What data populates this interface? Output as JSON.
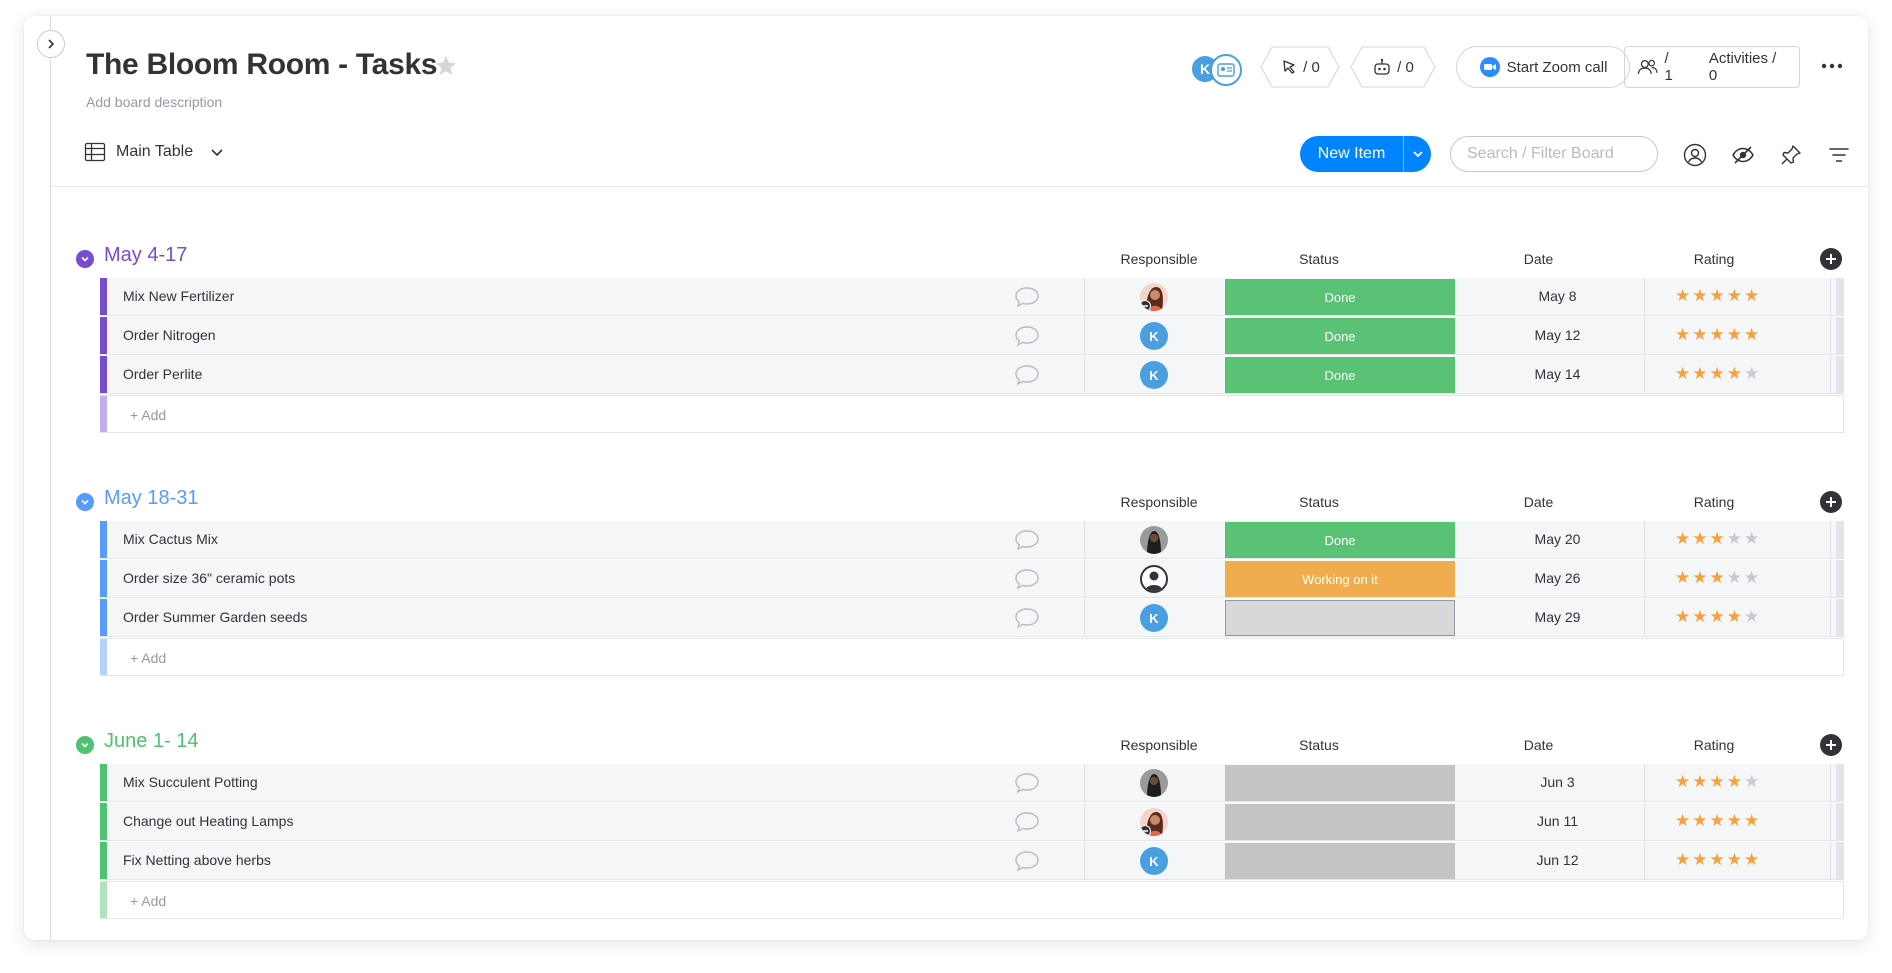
{
  "board": {
    "title": "The Bloom Room - Tasks",
    "description": "Add board description"
  },
  "header": {
    "avatar_initial": "K",
    "updates_count": "/ 0",
    "automations_count": "/ 0",
    "zoom_label": "Start Zoom call",
    "members_count": "/ 1",
    "activities_label": "Activities / 0"
  },
  "toolbar": {
    "view_label": "Main Table",
    "new_item_label": "New Item",
    "search_placeholder": "Search / Filter Board"
  },
  "columns": {
    "responsible": "Responsible",
    "status": "Status",
    "date": "Date",
    "rating": "Rating"
  },
  "colors": {
    "done": "#5ac274",
    "working": "#f0ad4e",
    "empty_status_1": "#d8d8d8",
    "empty_status_2": "#c4c4c4",
    "star_on": "#f5a23d",
    "star_off": "#c8c9cf"
  },
  "groups": [
    {
      "title": "May 4-17",
      "color": "#784bd1",
      "add_label": "+ Add",
      "items": [
        {
          "name": "Mix New Fertilizer",
          "responsible": "photo-woman",
          "status": "Done",
          "status_color": "#5ac274",
          "date": "May 8",
          "rating": 5
        },
        {
          "name": "Order Nitrogen",
          "responsible": "K",
          "status": "Done",
          "status_color": "#5ac274",
          "date": "May 12",
          "rating": 5
        },
        {
          "name": "Order Perlite",
          "responsible": "K",
          "status": "Done",
          "status_color": "#5ac274",
          "date": "May 14",
          "rating": 4
        }
      ]
    },
    {
      "title": "May 18-31",
      "color": "#579bfc",
      "add_label": "+ Add",
      "items": [
        {
          "name": "Mix Cactus Mix",
          "responsible": "photo-dark",
          "status": "Done",
          "status_color": "#5ac274",
          "date": "May 20",
          "rating": 3
        },
        {
          "name": "Order size 36\" ceramic pots",
          "responsible": "generic",
          "status": "Working on it",
          "status_color": "#f0ad4e",
          "date": "May 26",
          "rating": 3
        },
        {
          "name": "Order Summer Garden seeds",
          "responsible": "K",
          "status": "",
          "status_color": "#d8d8d8",
          "date": "May 29",
          "rating": 4
        }
      ]
    },
    {
      "title": "June 1- 14",
      "color": "#4ec26f",
      "add_label": "+ Add",
      "items": [
        {
          "name": "Mix Succulent Potting",
          "responsible": "photo-dark",
          "status": "",
          "status_color": "#c4c4c4",
          "date": "Jun 3",
          "rating": 4
        },
        {
          "name": "Change out Heating Lamps",
          "responsible": "photo-woman",
          "status": "",
          "status_color": "#c4c4c4",
          "date": "Jun 11",
          "rating": 5
        },
        {
          "name": "Fix Netting above herbs",
          "responsible": "K",
          "status": "",
          "status_color": "#c4c4c4",
          "date": "Jun 12",
          "rating": 5
        }
      ]
    }
  ]
}
